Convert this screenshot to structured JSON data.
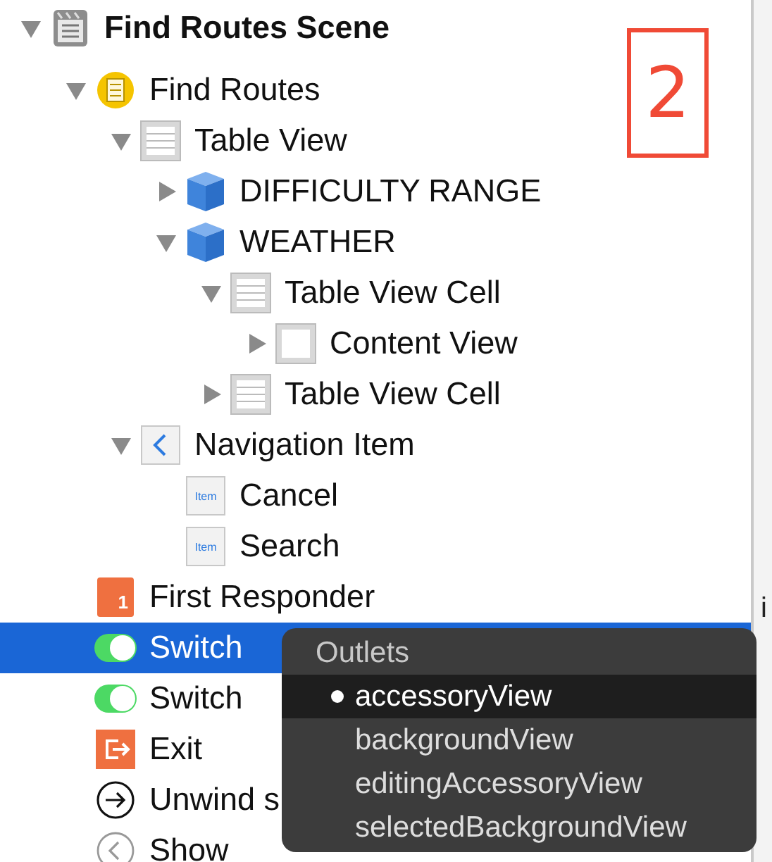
{
  "tree": [
    {
      "label": "Find Routes Scene",
      "kind": "scene",
      "expanded": true,
      "selected": false,
      "children": [
        {
          "label": "Find Routes",
          "kind": "controller",
          "expanded": true,
          "selected": false,
          "children": [
            {
              "label": "Table View",
              "kind": "table",
              "expanded": true,
              "selected": false,
              "children": [
                {
                  "label": "DIFFICULTY RANGE",
                  "kind": "section",
                  "expanded": false,
                  "selected": false
                },
                {
                  "label": "WEATHER",
                  "kind": "section",
                  "expanded": true,
                  "selected": false,
                  "children": [
                    {
                      "label": "Table View Cell",
                      "kind": "cell",
                      "expanded": true,
                      "selected": false,
                      "children": [
                        {
                          "label": "Content View",
                          "kind": "view",
                          "expanded": false,
                          "selected": false
                        }
                      ]
                    },
                    {
                      "label": "Table View Cell",
                      "kind": "cell",
                      "expanded": false,
                      "selected": false
                    }
                  ]
                }
              ]
            },
            {
              "label": "Navigation Item",
              "kind": "nav",
              "expanded": true,
              "selected": false,
              "children": [
                {
                  "label": "Cancel",
                  "kind": "bar-item",
                  "icon_text": "Item",
                  "selected": false
                },
                {
                  "label": "Search",
                  "kind": "bar-item",
                  "icon_text": "Item",
                  "selected": false
                }
              ]
            }
          ]
        },
        {
          "label": "First Responder",
          "kind": "responder",
          "icon_text": "1",
          "selected": false
        },
        {
          "label": "Switch",
          "kind": "switch",
          "selected": true
        },
        {
          "label": "Switch",
          "kind": "switch",
          "selected": false
        },
        {
          "label": "Exit",
          "kind": "exit",
          "selected": false
        },
        {
          "label": "Unwind s",
          "kind": "unwind",
          "selected": false
        },
        {
          "label": "Show",
          "kind": "show-segue",
          "selected": false
        }
      ]
    }
  ],
  "annotation": {
    "label": "2"
  },
  "outlets_popup": {
    "title": "Outlets",
    "items": [
      {
        "label": "accessoryView",
        "selected": true
      },
      {
        "label": "backgroundView",
        "selected": false
      },
      {
        "label": "editingAccessoryView",
        "selected": false
      },
      {
        "label": "selectedBackgroundView",
        "selected": false
      }
    ]
  },
  "side_panel": {
    "text": "i"
  }
}
